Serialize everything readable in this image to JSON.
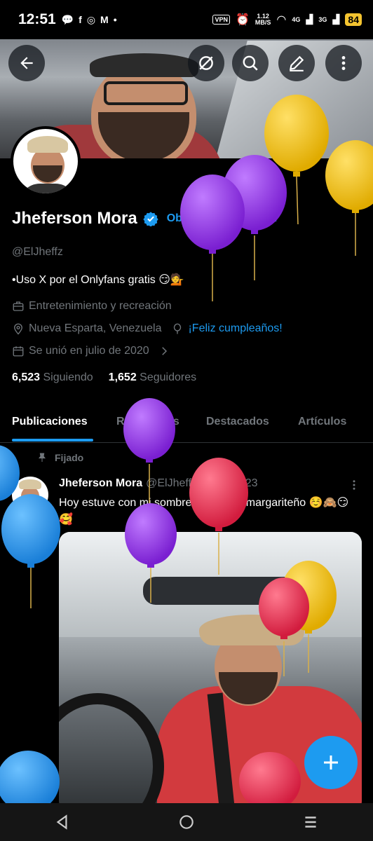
{
  "status_bar": {
    "time": "12:51",
    "notif_icons": [
      "chat-icon",
      "facebook-icon",
      "instagram-icon",
      "gmail-icon"
    ],
    "vpn": "VPN",
    "speed_value": "1.12",
    "speed_unit": "MB/S",
    "net_4g": "4G",
    "net_3g": "3G",
    "battery": "84"
  },
  "header": {
    "back_icon": "back-arrow-icon",
    "actions": [
      "grok-icon",
      "search-icon",
      "edit-icon",
      "more-icon"
    ]
  },
  "profile": {
    "name": "Jheferson Mora",
    "verify_link": "Obtén la verificación",
    "handle": "@ElJheffz",
    "bio": "•Uso X por el Onlyfans gratis 😏💁",
    "category": "Entretenimiento y recreación",
    "location": "Nueva Esparta, Venezuela",
    "birthday": "¡Feliz cumpleaños!",
    "joined": "Se unió en julio de 2020",
    "following_count": "6,523",
    "following_label": "Siguiendo",
    "followers_count": "1,652",
    "followers_label": "Seguidores"
  },
  "tabs": [
    {
      "label": "Publicaciones",
      "active": true
    },
    {
      "label": "Respuestas",
      "active": false
    },
    {
      "label": "Destacados",
      "active": false
    },
    {
      "label": "Artículos",
      "active": false
    }
  ],
  "post": {
    "pinned_label": "Fijado",
    "author": "Jheferson Mora",
    "handle": "@ElJheffz",
    "separator": "·",
    "date": "29 ene 23",
    "text": "Hoy estuve con mi sombrero al estilo margariteño ☺️🙈😏🥰"
  },
  "fab": {
    "icon": "plus-icon"
  },
  "colors": {
    "accent": "#1d9bf0",
    "background": "#000000",
    "secondary_text": "#71767b",
    "balloon_purple": "#8a2be2",
    "balloon_yellow": "#f2c200",
    "balloon_red": "#e0344f",
    "balloon_blue": "#2a8fe8"
  }
}
